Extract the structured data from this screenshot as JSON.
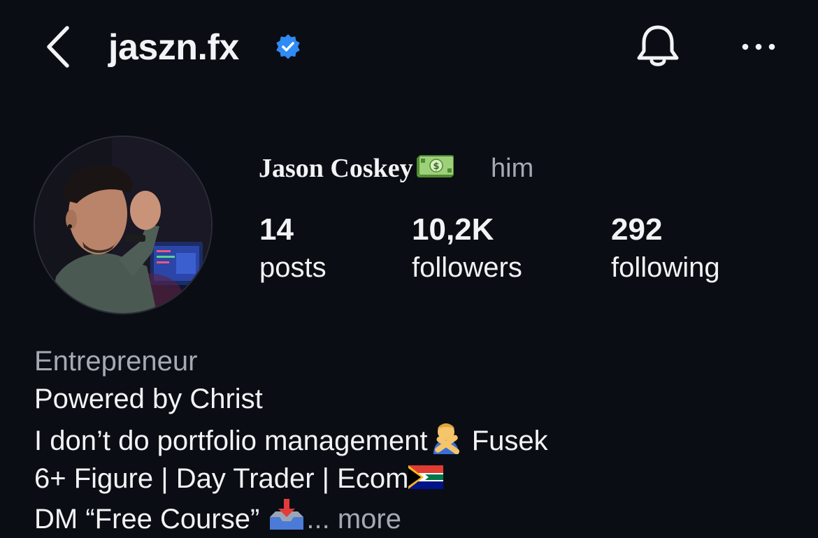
{
  "header": {
    "username": "jaszn.fx",
    "verified": true,
    "accent_color": "#2f8bf6"
  },
  "profile": {
    "display_name": "Jason Coskey",
    "name_emoji_icon": "money-bill-icon",
    "pronouns": "him",
    "avatar_icon": "profile-photo"
  },
  "stats": {
    "posts": {
      "value": "14",
      "label": "posts"
    },
    "followers": {
      "value": "10,2K",
      "label": "followers"
    },
    "following": {
      "value": "292",
      "label": "following"
    }
  },
  "bio": {
    "category": "Entrepreneur",
    "line1": "Powered by Christ",
    "line2_text": "I don’t do portfolio management",
    "line2_emoji_icon": "person-gesturing-no-icon",
    "line2_suffix": " Fusek",
    "line3_text": "6+ Figure | Day Trader | Ecom",
    "line3_emoji_icon": "south-africa-flag-icon",
    "line4_text": "DM “Free Course” ",
    "line4_emoji_icon": "inbox-tray-icon",
    "ellipsis": "...",
    "more_label": "more"
  }
}
